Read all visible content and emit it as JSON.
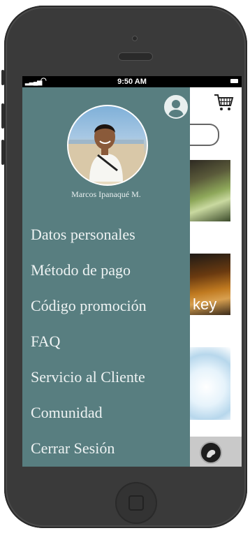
{
  "status_bar": {
    "time": "9:50 AM"
  },
  "drawer": {
    "user_name": "Marcos Ipanaqué M.",
    "menu_items": [
      "Datos personales",
      "Método de pago",
      "Código promoción",
      "FAQ",
      "Servicio al Cliente",
      "Comunidad",
      "Cerrar Sesión"
    ]
  },
  "content": {
    "tile2_text": "key"
  },
  "colors": {
    "drawer_bg": "#587e80",
    "menu_text": "#eef3f3",
    "phone_body": "#3a3a3a",
    "bottom_bar": "#c9c9c9"
  },
  "icons": {
    "profile": "person-silhouette-icon",
    "cart": "shopping-cart-icon",
    "bottom_app": "app-logo-icon"
  }
}
